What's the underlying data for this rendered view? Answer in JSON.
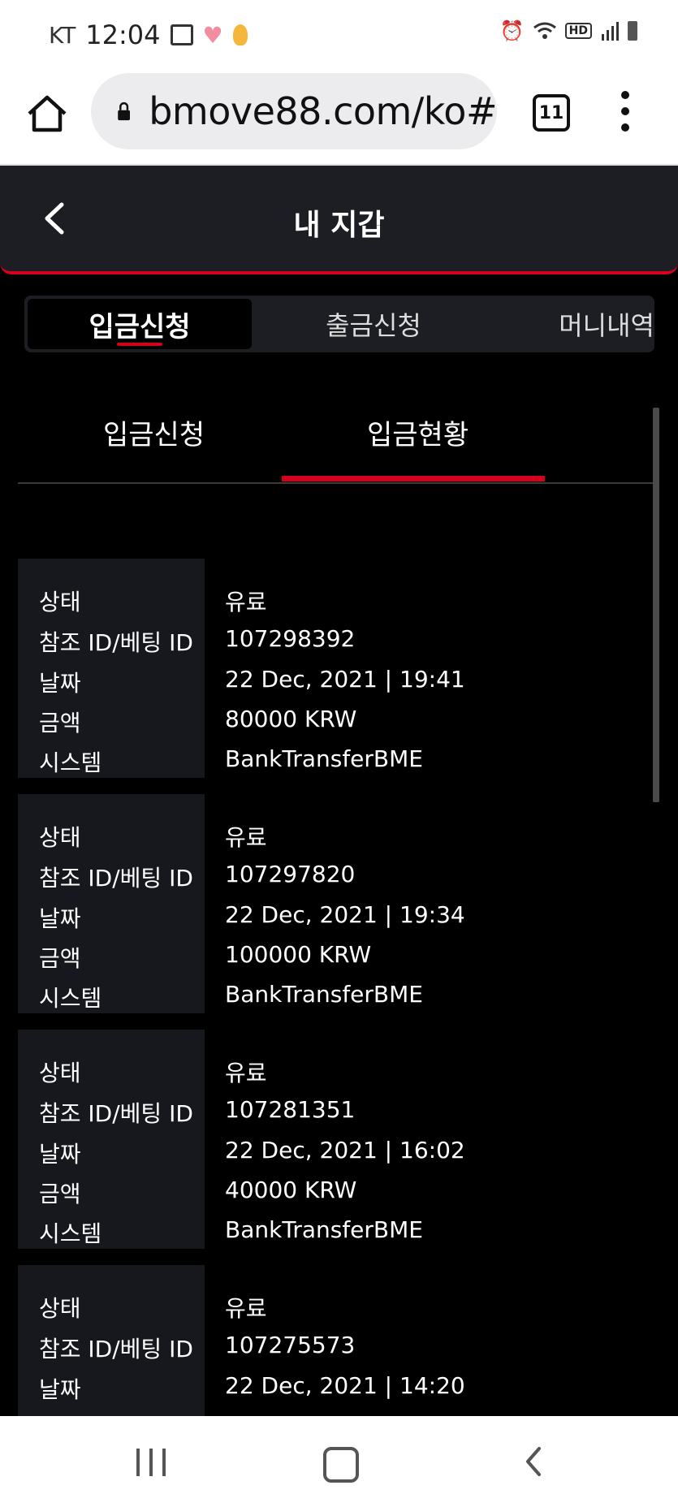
{
  "status_bar": {
    "carrier": "KT",
    "time": "12:04",
    "hd_label": "HD"
  },
  "browser": {
    "url": "bmove88.com/ko#",
    "tab_count": "11"
  },
  "header": {
    "title": "내 지갑"
  },
  "main_tabs": [
    {
      "label": "입금신청",
      "active": true
    },
    {
      "label": "출금신청",
      "active": false
    },
    {
      "label": "머니내역",
      "active": false
    }
  ],
  "sub_tabs": [
    {
      "label": "입금신청",
      "active": false
    },
    {
      "label": "입금현황",
      "active": true
    }
  ],
  "field_labels": {
    "status": "상태",
    "ref_id": "참조 ID/베팅 ID",
    "date": "날짜",
    "amount": "금액",
    "system": "시스템"
  },
  "records": [
    {
      "status": "유료",
      "ref_id": "107298392",
      "date": "22 Dec, 2021 | 19:41",
      "amount": "80000 KRW",
      "system": "BankTransferBME"
    },
    {
      "status": "유료",
      "ref_id": "107297820",
      "date": "22 Dec, 2021 | 19:34",
      "amount": "100000 KRW",
      "system": "BankTransferBME"
    },
    {
      "status": "유료",
      "ref_id": "107281351",
      "date": "22 Dec, 2021 | 16:02",
      "amount": "40000 KRW",
      "system": "BankTransferBME"
    },
    {
      "status": "유료",
      "ref_id": "107275573",
      "date": "22 Dec, 2021 | 14:20",
      "amount": "",
      "system": ""
    }
  ],
  "colors": {
    "accent": "#d6001c",
    "header_bg": "#1c1e24",
    "label_bg": "#16181d"
  }
}
